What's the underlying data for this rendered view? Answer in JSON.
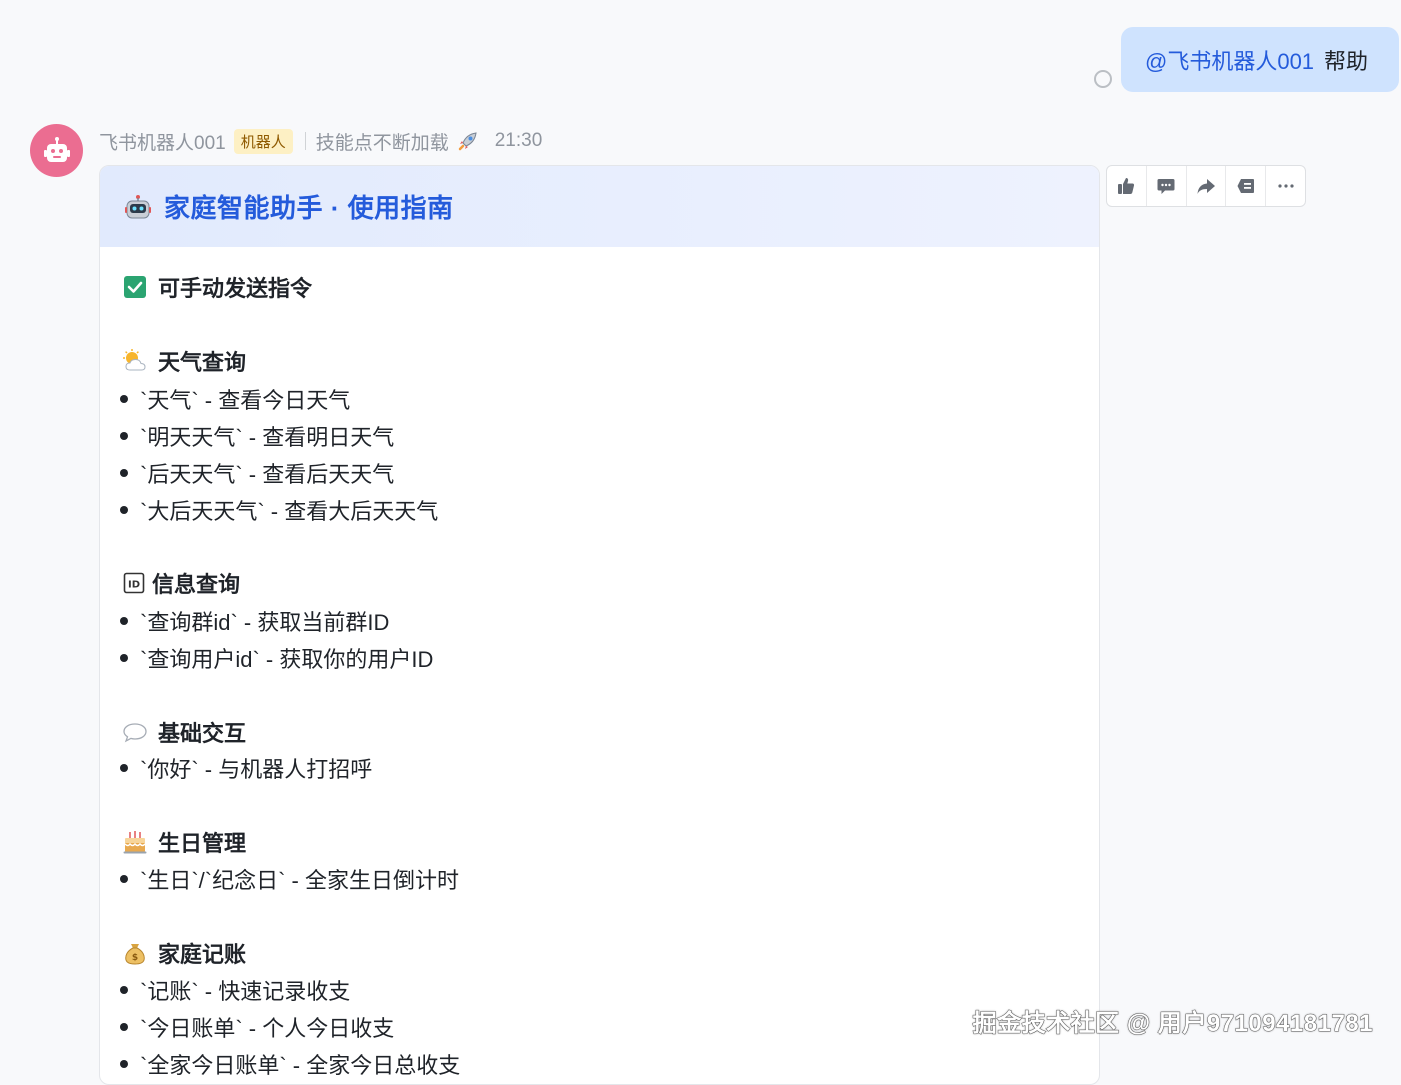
{
  "user_message": {
    "mention": "@飞书机器人001",
    "text": "帮助"
  },
  "bot": {
    "name": "飞书机器人001",
    "badge": "机器人",
    "signature": "技能点不断加载",
    "time": "21:30"
  },
  "card": {
    "title": "家庭智能助手 · 使用指南",
    "intro": "可手动发送指令",
    "sections": [
      {
        "icon": "sun-cloud-icon",
        "title": "天气查询",
        "items": [
          "`天气` - 查看今日天气",
          "`明天天气` - 查看明日天气",
          "`后天天气` - 查看后天天气",
          "`大后天天气` - 查看大后天天气"
        ]
      },
      {
        "icon": "id-icon",
        "title": "信息查询",
        "items": [
          "`查询群id` - 获取当前群ID",
          "`查询用户id` - 获取你的用户ID"
        ]
      },
      {
        "icon": "speech-bubble-icon",
        "title": "基础交互",
        "items": [
          "`你好` - 与机器人打招呼"
        ]
      },
      {
        "icon": "birthday-cake-icon",
        "title": "生日管理",
        "items": [
          "`生日`/`纪念日` - 全家生日倒计时"
        ]
      },
      {
        "icon": "money-bag-icon",
        "title": "家庭记账",
        "items": [
          "`记账` - 快速记录收支",
          "`今日账单` - 个人今日收支",
          "`全家今日账单` - 全家今日总收支"
        ]
      }
    ]
  },
  "toolbar": [
    "thumbs-up-icon",
    "comment-icon",
    "forward-icon",
    "pin-icon",
    "more-icon"
  ],
  "watermark": "掘金技术社区 @ 用户971094181781",
  "colors": {
    "accent": "#245bdb",
    "bubble": "#cfe3fe",
    "avatar": "#eb6d91",
    "check": "#2ba471"
  }
}
